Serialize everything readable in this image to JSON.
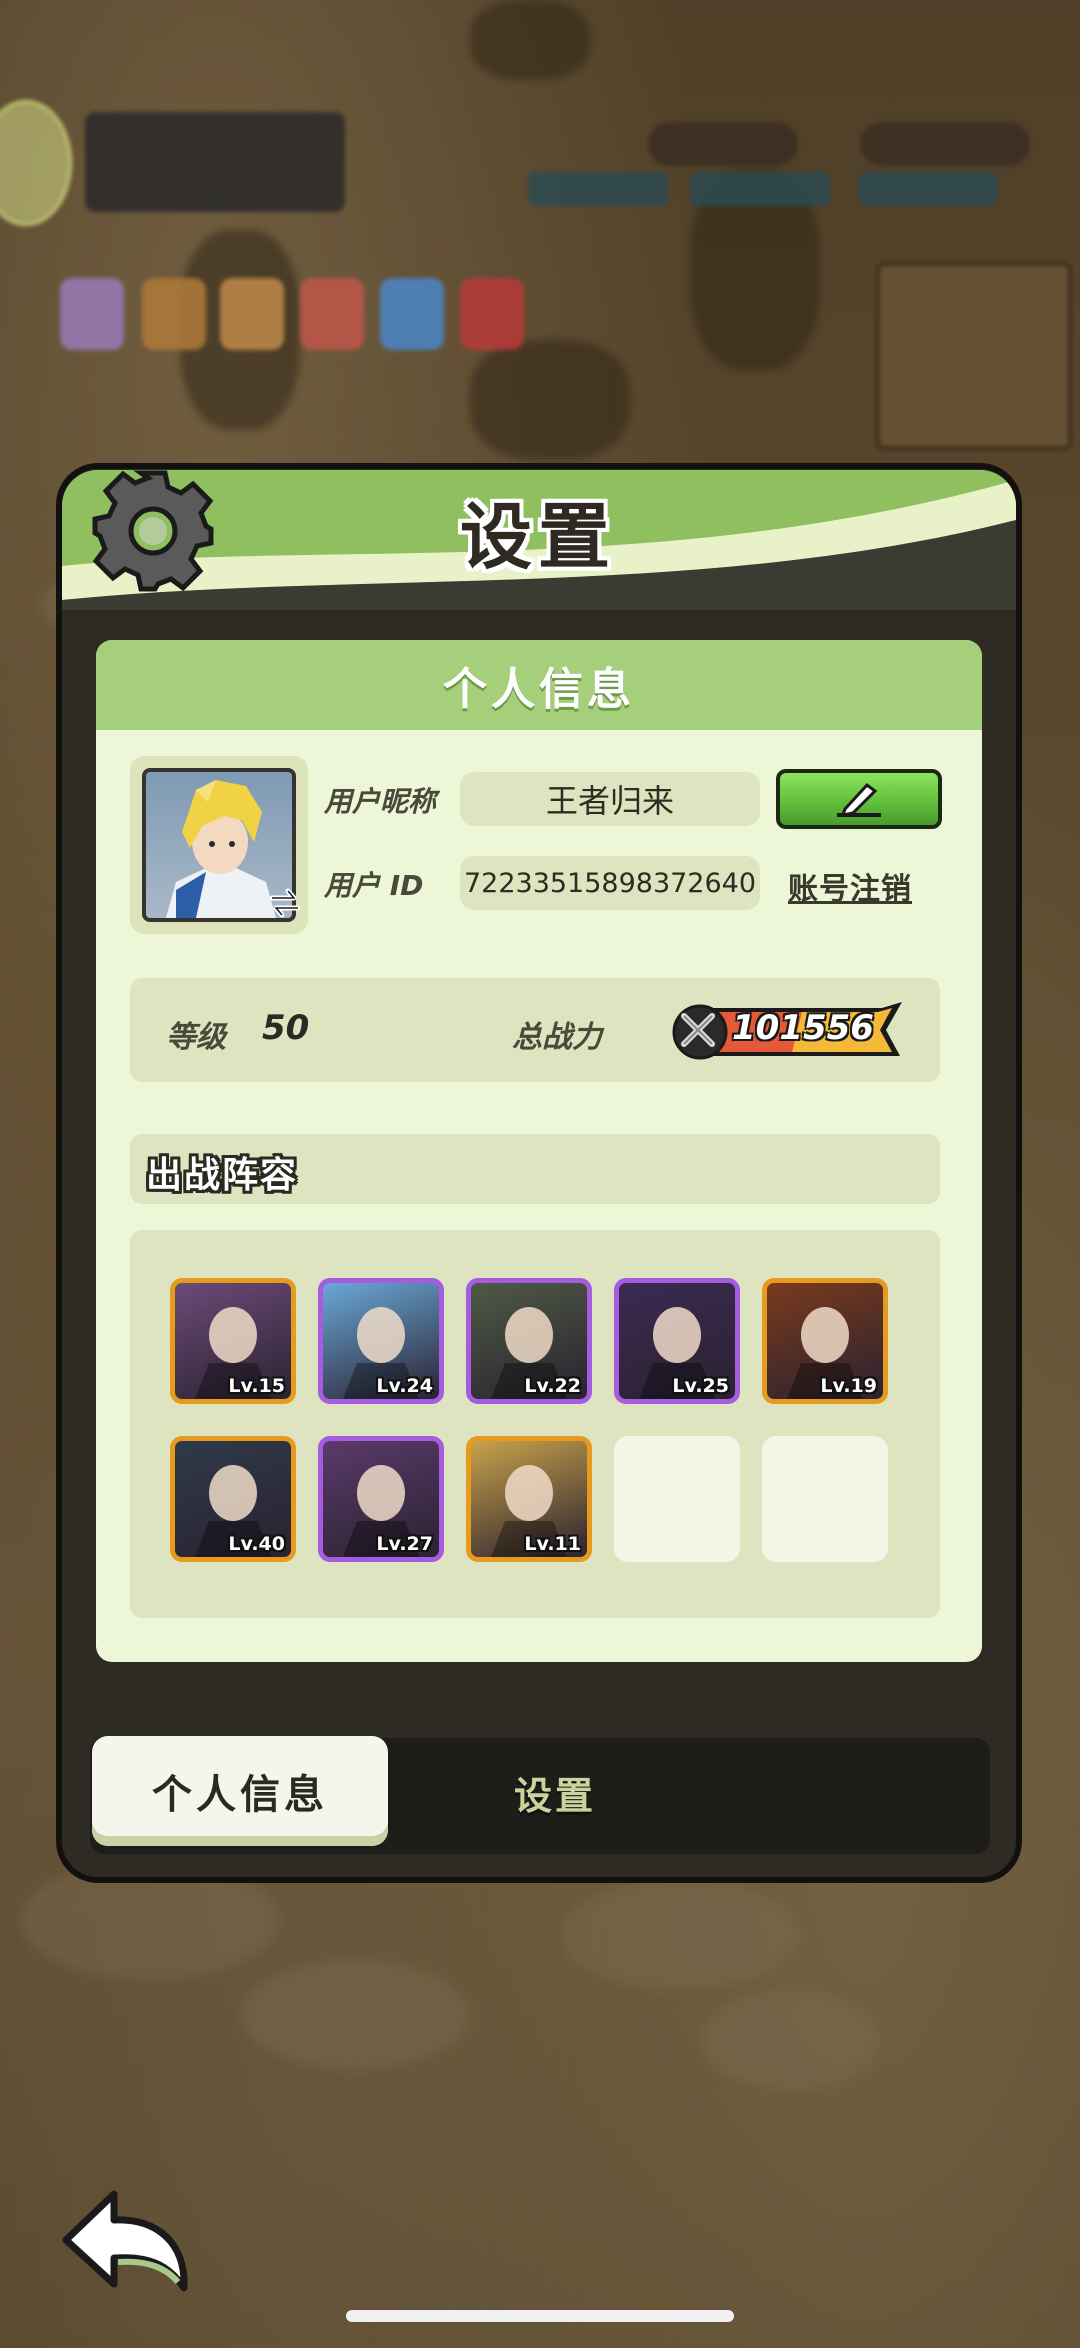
{
  "header": {
    "title": "设置"
  },
  "profile": {
    "section_title": "个人信息",
    "nickname_label": "用户昵称",
    "nickname": "王者归来",
    "id_label": "用户 ID",
    "user_id": "72233515898372640",
    "logout_label": "账号注销"
  },
  "stats": {
    "level_label": "等级",
    "level": "50",
    "power_label": "总战力",
    "power": "101556"
  },
  "team": {
    "title": "出战阵容",
    "heroes": [
      {
        "level": "Lv.15",
        "rarity": "orange",
        "color": "#6b4a78"
      },
      {
        "level": "Lv.24",
        "rarity": "purple",
        "color": "#6aa8d8"
      },
      {
        "level": "Lv.22",
        "rarity": "purple",
        "color": "#4e5a44"
      },
      {
        "level": "Lv.25",
        "rarity": "purple",
        "color": "#3b2a52"
      },
      {
        "level": "Lv.19",
        "rarity": "orange",
        "color": "#7a3a1c"
      },
      {
        "level": "Lv.40",
        "rarity": "orange",
        "color": "#2f3a4a"
      },
      {
        "level": "Lv.27",
        "rarity": "purple",
        "color": "#5a3a6a"
      },
      {
        "level": "Lv.11",
        "rarity": "orange",
        "color": "#c8a24a"
      }
    ],
    "empty_slots": 2
  },
  "tabs": {
    "active": "个人信息",
    "inactive": "设置"
  },
  "colors": {
    "accent_green": "#8fbf5f",
    "orange_frame": "#e69a1e",
    "purple_frame": "#a65ce0"
  },
  "icons": [
    "gear-icon",
    "edit-pencil-icon",
    "swap-icon",
    "sword-power-icon",
    "back-arrow-icon"
  ]
}
